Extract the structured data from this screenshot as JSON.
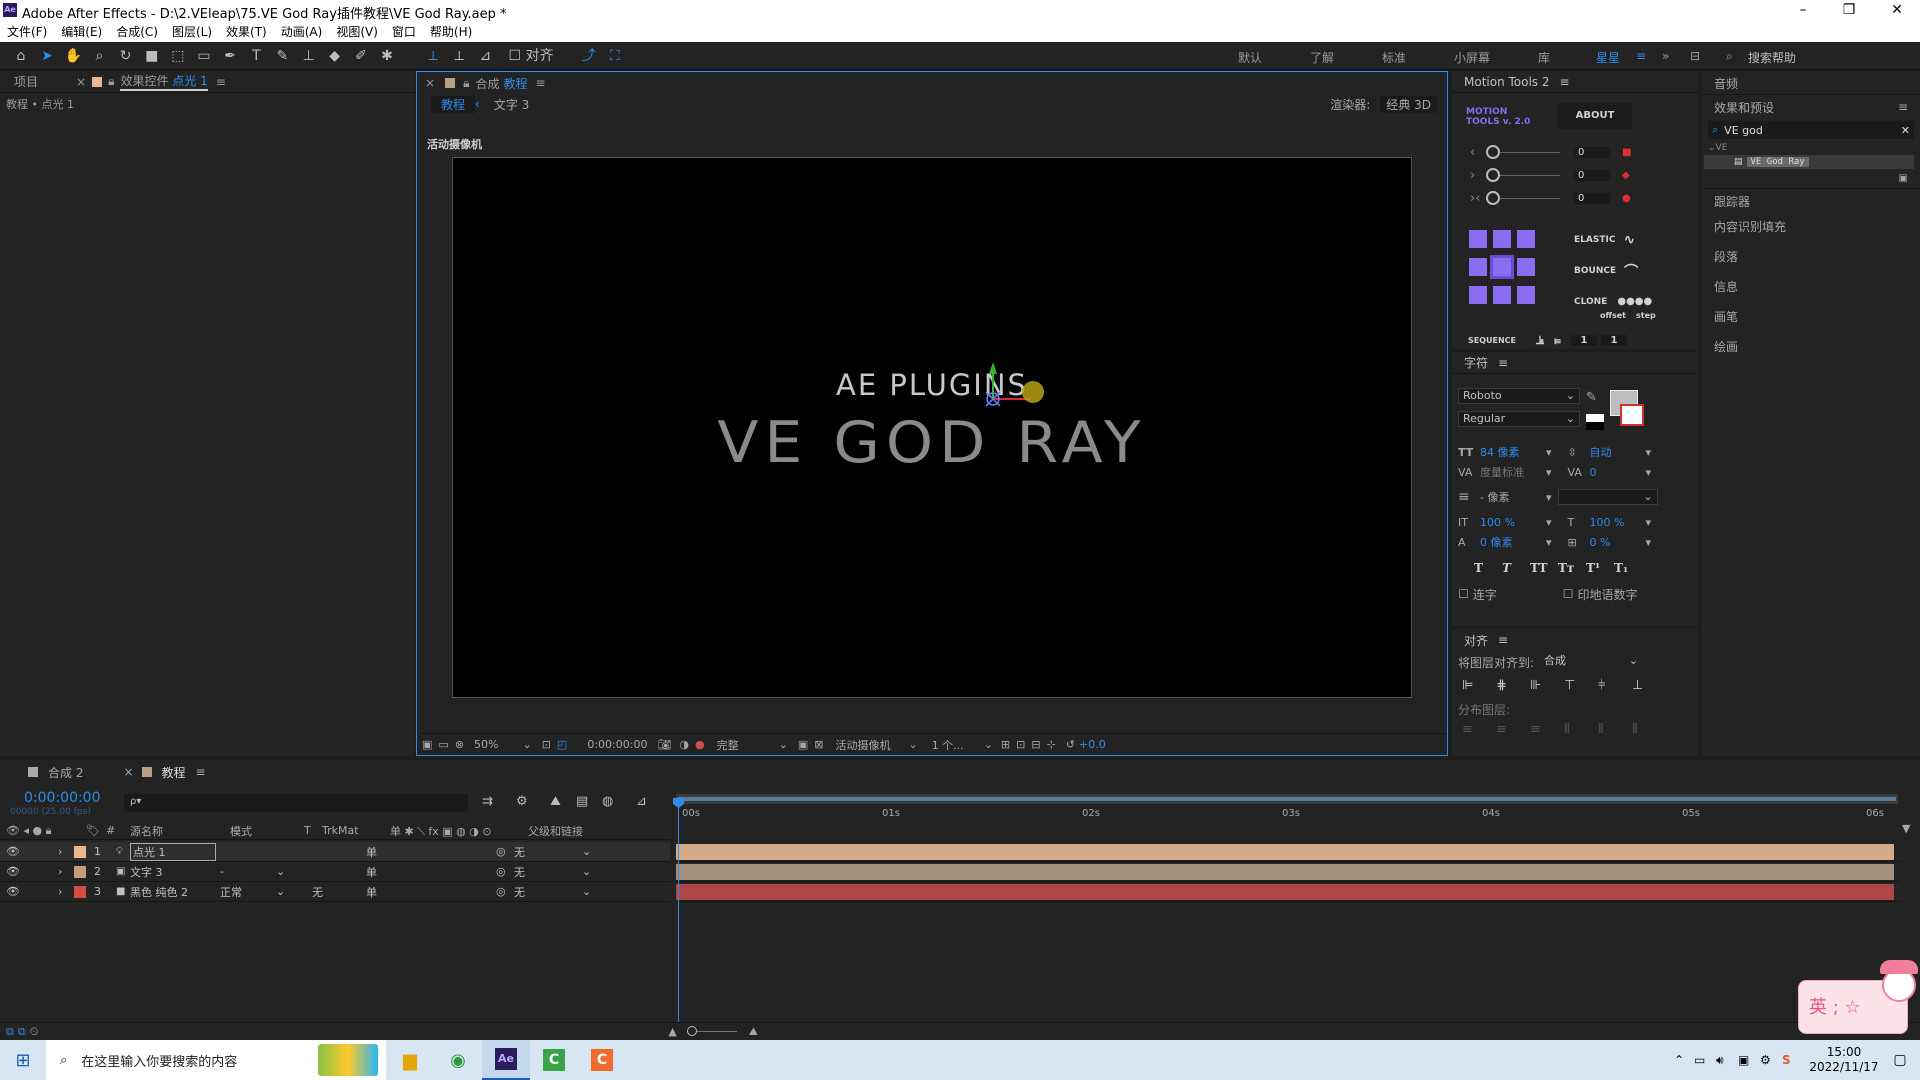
{
  "window": {
    "title": "Adobe After Effects - D:\\2.VEleap\\75.VE God Ray插件教程\\VE God Ray.aep *",
    "logo_text": "Ae"
  },
  "menu": [
    "文件(F)",
    "编辑(E)",
    "合成(C)",
    "图层(L)",
    "效果(T)",
    "动画(A)",
    "视图(V)",
    "窗口",
    "帮助(H)"
  ],
  "toolbar": {
    "align_label": "对齐",
    "workspaces": [
      "默认",
      "了解",
      "标准",
      "小屏幕",
      "库",
      "星星"
    ],
    "search_placeholder": "搜索帮助"
  },
  "left_panel": {
    "tab_project": "项目",
    "tab_effects": "效果控件",
    "tab_effects_layer": "点光 1",
    "path": "教程 • 点光 1"
  },
  "comp_panel": {
    "tab_prefix": "合成",
    "tab_name": "教程",
    "flow_active": "教程",
    "flow_next": "文字 3",
    "renderer_label": "渲染器:",
    "renderer_value": "经典 3D",
    "camera_label": "活动摄像机",
    "canvas_text1": "AE PLUGINS",
    "canvas_text2": "VE GOD RAY",
    "zoom": "50%",
    "timecode": "0:00:00:00",
    "resolution": "完整",
    "view_camera": "活动摄像机",
    "views": "1 个...",
    "exposure": "+0.0"
  },
  "motion_tools": {
    "title": "Motion Tools 2",
    "logo_line1": "MOTION",
    "logo_line2": "TOOLS v. 2.0",
    "about": "ABOUT",
    "sliders": [
      {
        "value": "0"
      },
      {
        "value": "0"
      },
      {
        "value": "0"
      }
    ],
    "elastic": "ELASTIC",
    "bounce": "BOUNCE",
    "clone": "CLONE",
    "offset": "offset",
    "step": "step",
    "sequence": "SEQUENCE",
    "seq_a": "1",
    "seq_b": "1"
  },
  "character": {
    "title": "字符",
    "font": "Roboto",
    "style": "Regular",
    "size": "84 像素",
    "leading": "自动",
    "kerning": "度量标准",
    "tracking": "0",
    "stroke": "- 像素",
    "vscale": "100 %",
    "hscale": "100 %",
    "baseline": "0 像素",
    "tsume": "0 %",
    "ligature": "连字",
    "hindi": "印地语数字"
  },
  "align": {
    "title": "对齐",
    "align_to_label": "将图层对齐到:",
    "align_to_value": "合成",
    "distribute": "分布图层:"
  },
  "right_col": {
    "audio": "音频",
    "effects_presets": "效果和预设",
    "search_value": "VE god",
    "tree_group": "VE",
    "tree_item": "VE God Ray",
    "items": [
      "跟踪器",
      "内容识别填充",
      "段落",
      "信息",
      "画笔",
      "绘画"
    ]
  },
  "timeline": {
    "tab1": "合成 2",
    "tab2": "教程",
    "timecode": "0:00:00:00",
    "fps": "00000 (25.00 fps)",
    "search_placeholder": "ρ▾",
    "headers": {
      "num": "#",
      "source": "源名称",
      "mode": "模式",
      "t": "T",
      "trkmat": "TrkMat",
      "parent": "父级和链接"
    },
    "ruler": [
      "00s",
      "01s",
      "02s",
      "03s",
      "04s",
      "05s",
      "06s"
    ],
    "layers": [
      {
        "num": "1",
        "name": "点光 1",
        "color": "#e7b996",
        "mode": "",
        "trkmat": "",
        "parent": "无",
        "bar": "#d6a988"
      },
      {
        "num": "2",
        "name": "文字 3",
        "color": "#c6a27a",
        "mode": "-",
        "trkmat": "",
        "parent": "无",
        "bar": "#a6927f"
      },
      {
        "num": "3",
        "name": "黑色 纯色 2",
        "color": "#d84b4b",
        "mode": "正常",
        "trkmat": "无",
        "parent": "无",
        "bar": "#b04848"
      }
    ]
  },
  "ime": {
    "text": "英 ; ☆"
  },
  "taskbar": {
    "search": "在这里输入你要搜索的内容",
    "time": "15:00",
    "date": "2022/11/17"
  }
}
